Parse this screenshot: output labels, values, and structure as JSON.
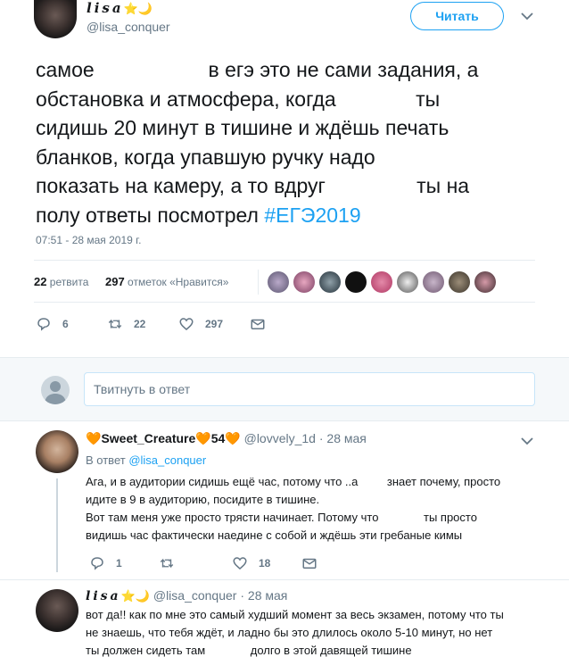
{
  "main_tweet": {
    "author_name": "lisa",
    "author_handle": "@lisa_conquer",
    "follow_label": "Читать",
    "text": "самое                    в егэ это не сами задания, а\nобстановка и атмосфера, когда              ты\nсидишь 20 минут в тишине и ждёшь печать\nбланков, когда упавшую ручку надо\nпоказать на камеру, а то вдруг                ты на\nполу ответы посмотрел ",
    "hashtag": "#ЕГЭ2019",
    "timestamp": "07:51 - 28 мая 2019 г.",
    "retweets_count": "22",
    "retweets_label": " ретвита",
    "likes_count": "297",
    "likes_label": " отметок «Нравится»",
    "reply_count": "6",
    "retweet_count_action": "22",
    "like_count_action": "297"
  },
  "reply_box": {
    "placeholder": "Твитнуть в ответ"
  },
  "replies": [
    {
      "name": "Sweet_Creature",
      "name_suffix": "54",
      "handle": "@lovvely_1d",
      "time": "· 28 мая",
      "in_reply_prefix": "В ответ ",
      "in_reply_handle": "@lisa_conquer",
      "text": "Ага, и в аудитории сидишь ещё час, потому что ..а         знает почему, просто\nидите в 9 в аудиторию, посидите в тишине.\nВот там меня уже просто трясти начинает. Потому что              ты просто\nвидишь час фактически наедине с собой и ждёшь эти гребаные кимы",
      "reply_count": "1",
      "like_count": "18"
    },
    {
      "name": "lisa",
      "handle": "@lisa_conquer",
      "time": "· 28 мая",
      "text": "вот да!! как по мне это самый худший момент за весь экзамен, потому что ты\nне знаешь, что тебя ждёт, и ладно бы это длилось около 5-10 минут, но нет\nты должен сидеть там              долго в этой давящей тишине"
    }
  ],
  "colors": {
    "accent": "#1da1f2",
    "text": "#14171a",
    "muted": "#657786",
    "border": "#e6ecf0",
    "heart_emoji": "#f5a623"
  },
  "icons": [
    "reply-icon",
    "retweet-icon",
    "like-icon",
    "message-icon",
    "chevron-down-icon",
    "star-emoji-icon",
    "heart-emoji-icon"
  ]
}
